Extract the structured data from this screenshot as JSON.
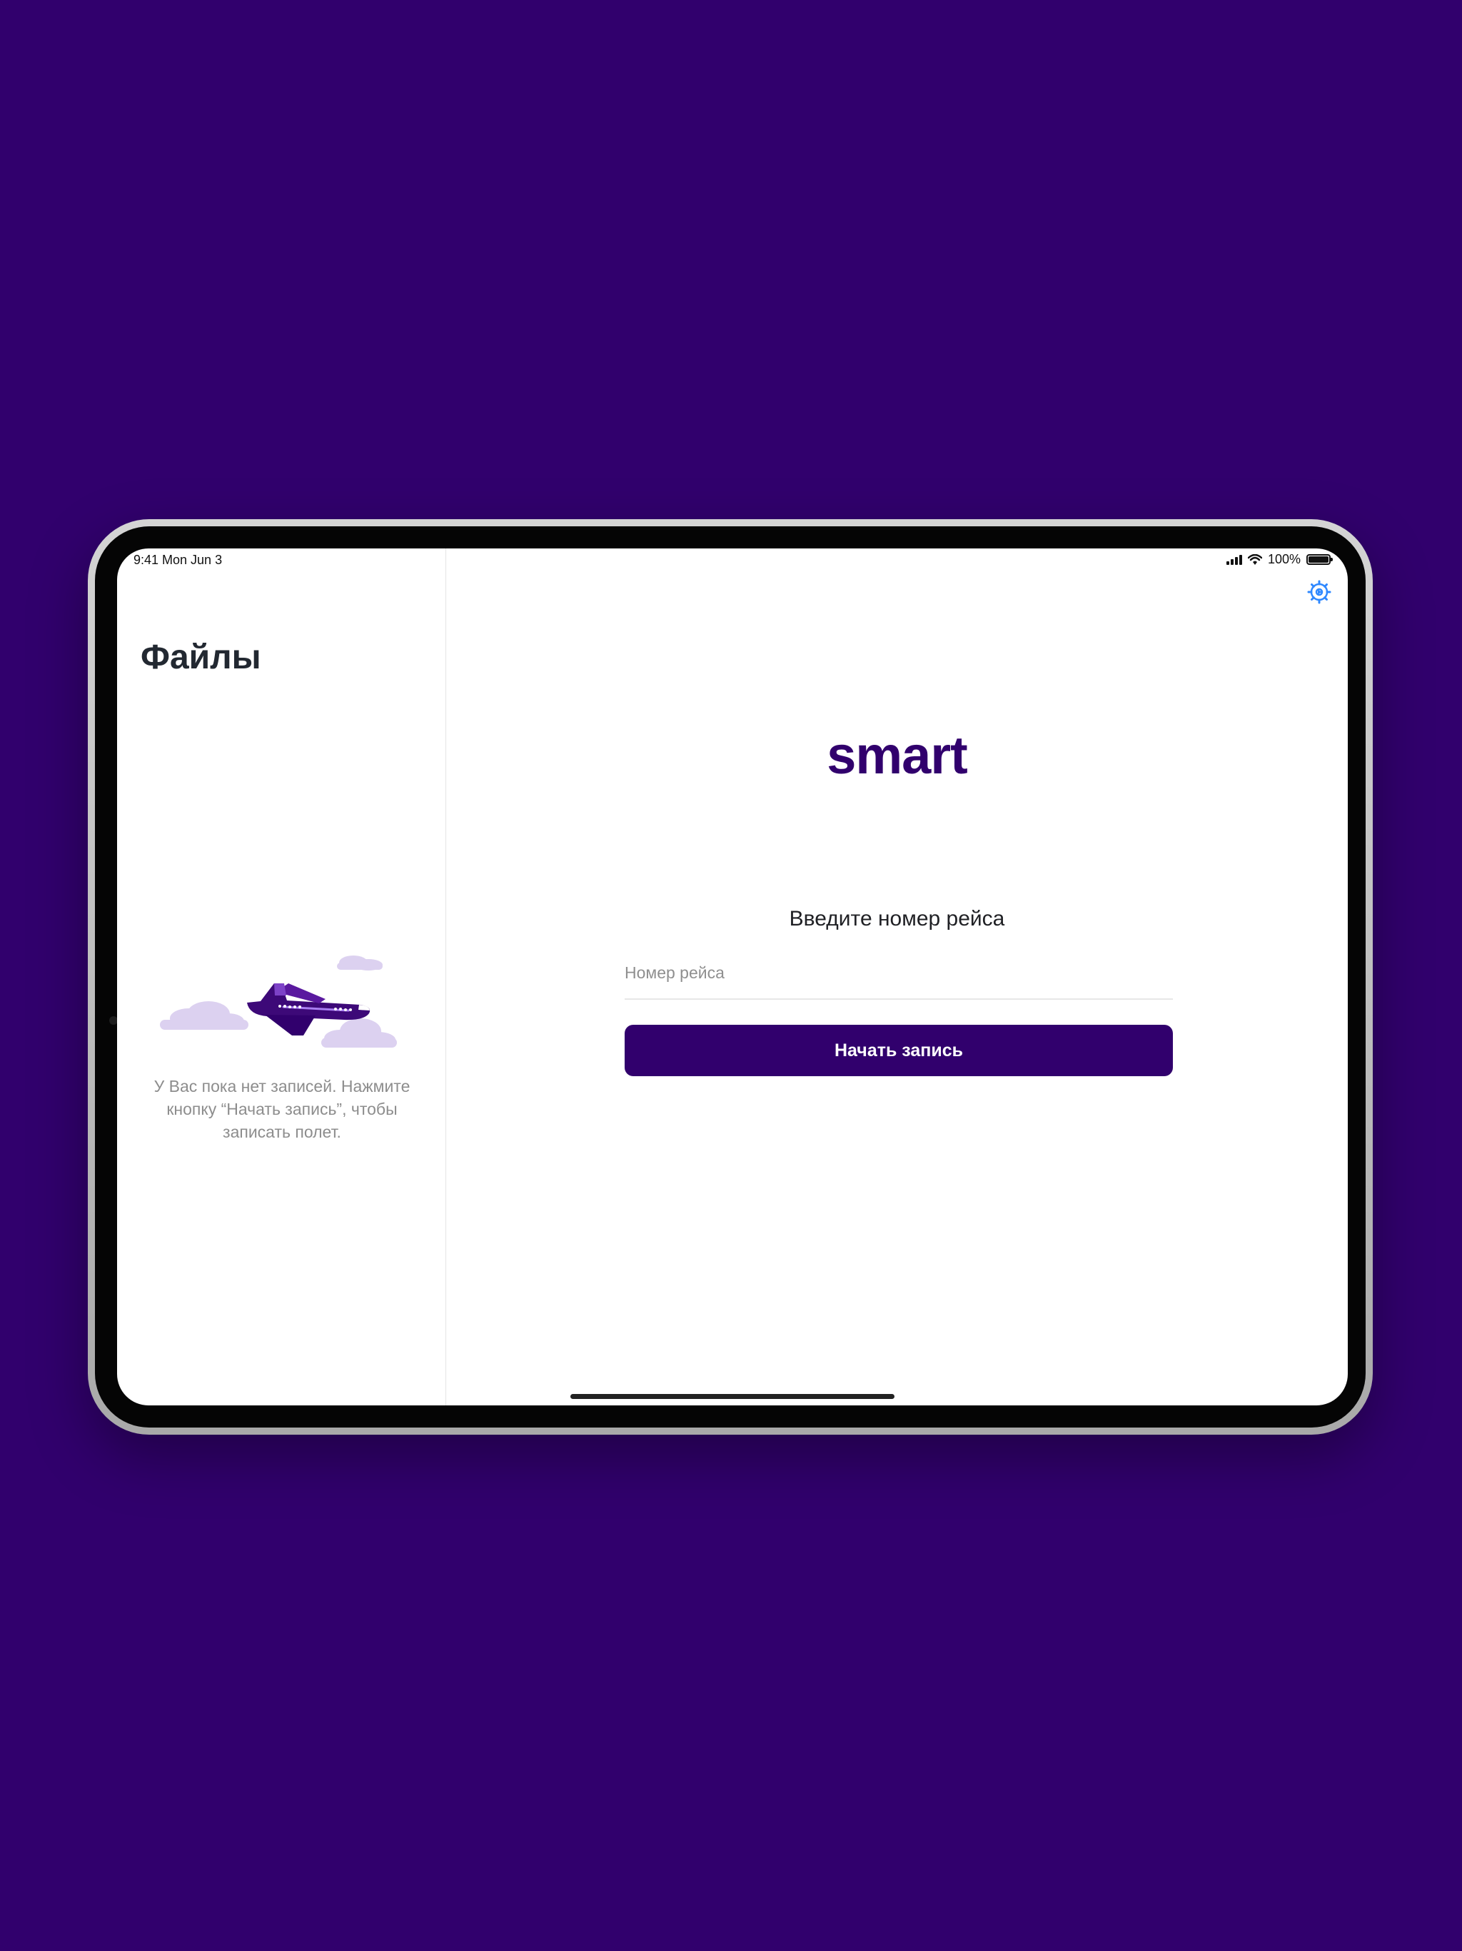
{
  "status_bar": {
    "time_date": "9:41  Mon Jun 3",
    "battery": "100%",
    "battery_level": 1.0,
    "icons": [
      "signal-icon",
      "wifi-icon",
      "battery-icon"
    ]
  },
  "sidebar": {
    "title": "Файлы",
    "empty_message": "У Вас пока нет записей. Нажмите кнопку “Начать запись”, чтобы записать полет."
  },
  "main": {
    "logo_text": "smart",
    "prompt": "Введите номер рейса",
    "flight_input": {
      "value": "",
      "placeholder": "Номер рейса"
    },
    "start_button": "Начать запись",
    "settings_icon": "gear-icon"
  },
  "colors": {
    "background": "#31006d",
    "brand": "#31006d",
    "accent": "#2f88ff",
    "text_primary": "#222831",
    "text_muted": "#8d8d8d"
  }
}
